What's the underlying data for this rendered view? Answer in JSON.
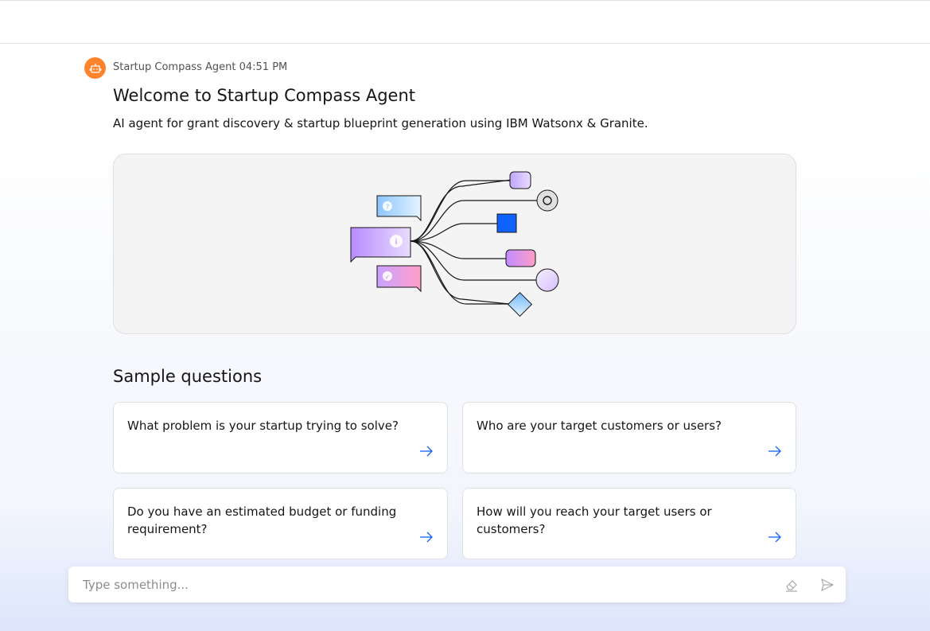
{
  "message": {
    "sender": "Startup Compass Agent",
    "time": "04:51 PM",
    "title": "Welcome to Startup Compass Agent",
    "subtitle": "AI agent for grant discovery & startup blueprint generation using IBM Watsonx & Granite."
  },
  "samples": {
    "heading": "Sample questions",
    "items": [
      "What problem is your startup trying to solve?",
      "Who are your target customers or users?",
      "Do you have an estimated budget or funding requirement?",
      "How will you reach your target users or customers?"
    ]
  },
  "input": {
    "placeholder": "Type something..."
  },
  "colors": {
    "avatar": "#ff832b",
    "accent": "#0f62fe"
  },
  "icons": {
    "avatar": "robot-icon",
    "card_arrow": "arrow-right-icon",
    "clear": "eraser-icon",
    "send": "send-icon"
  }
}
